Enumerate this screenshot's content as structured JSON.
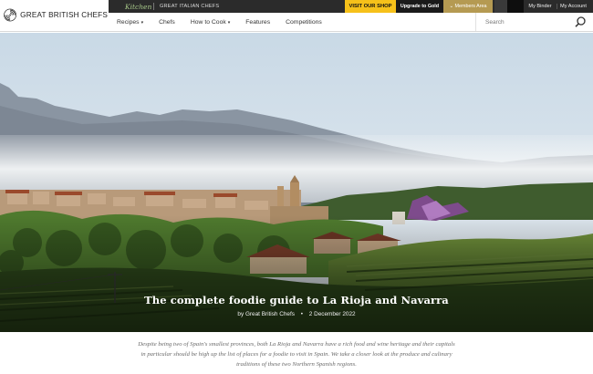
{
  "brand": {
    "name": "GREAT BRITISH CHEFS",
    "logo_icon": "gbc-swirl-logo"
  },
  "topbar": {
    "kitchen_label": "Kitchen",
    "italian_label": "GREAT ITALIAN CHEFS",
    "shop_label": "VISIT OUR SHOP",
    "upgrade_label": "Upgrade to Gold",
    "members_label": "Members Area",
    "binder_label": "My Binder",
    "account_label": "My Account",
    "colors": {
      "shop": "#f6c11a",
      "members": "#b59a52",
      "bar": "#2b2b2b"
    }
  },
  "nav": {
    "items": [
      {
        "label": "Recipes",
        "dropdown": true
      },
      {
        "label": "Chefs",
        "dropdown": false
      },
      {
        "label": "How to Cook",
        "dropdown": true
      },
      {
        "label": "Features",
        "dropdown": false
      },
      {
        "label": "Competitions",
        "dropdown": false
      }
    ],
    "caret": "▾"
  },
  "search": {
    "placeholder": "Search",
    "icon": "search-icon"
  },
  "hero": {
    "title": "The complete foodie guide to La Rioja and Navarra",
    "author": "by Great British Chefs",
    "separator": "•",
    "date": "2 December 2022"
  },
  "intro": {
    "text": "Despite being two of Spain's smallest provinces, both La Rioja and Navarra have a rich food and wine heritage and their capitals in particular should be high up the list of places for a foodie to visit in Spain. We take a closer look at the produce and culinary traditions of these two Northern Spanish regions."
  }
}
